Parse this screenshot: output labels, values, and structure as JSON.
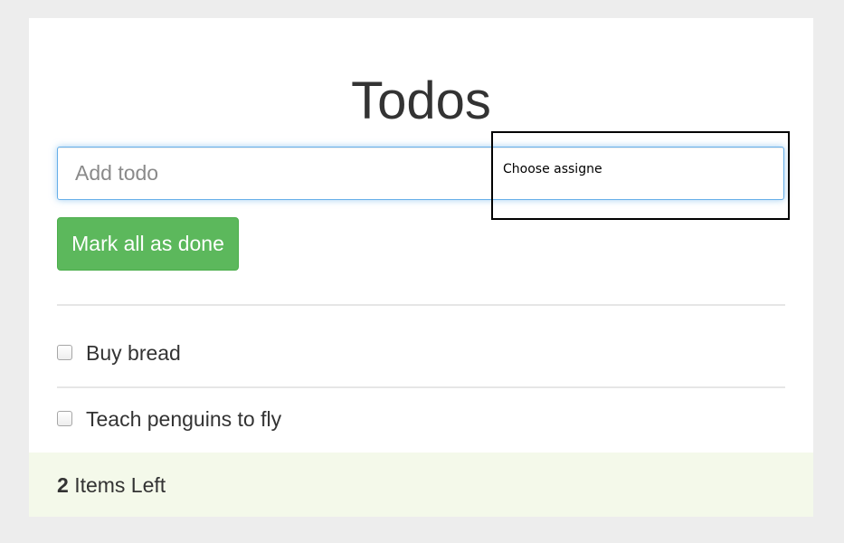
{
  "header": {
    "title": "Todos"
  },
  "new_todo": {
    "placeholder": "Add todo",
    "value": ""
  },
  "assignee": {
    "label": "Choose assigne"
  },
  "actions": {
    "mark_all_label": "Mark all as done"
  },
  "todos": [
    {
      "text": "Buy bread",
      "done": false
    },
    {
      "text": "Teach penguins to fly",
      "done": false
    }
  ],
  "footer": {
    "count": "2",
    "suffix": "Items Left"
  },
  "colors": {
    "page_background": "#ededed",
    "card_background": "#ffffff",
    "input_focus_border": "#66afe9",
    "success_button": "#5cb85c",
    "footer_background": "#f4f9ea",
    "text": "#333333"
  }
}
